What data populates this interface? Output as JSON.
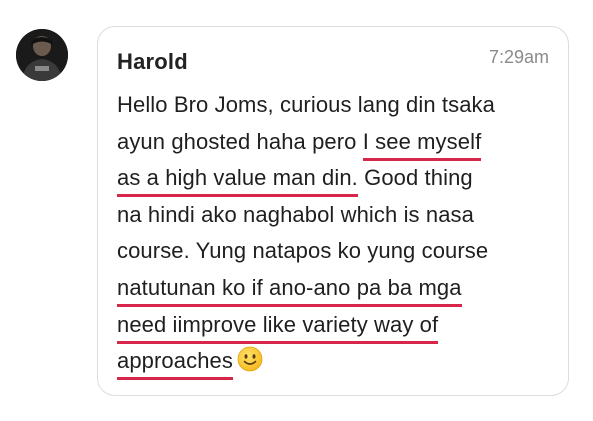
{
  "comment": {
    "author": "Harold",
    "time": "7:29am",
    "lines": [
      {
        "before": "Hello Bro Joms, curious lang din tsaka",
        "highlight": "",
        "after": ""
      },
      {
        "before": "ayun ghosted haha pero ",
        "highlight": "I see myself",
        "after": ""
      },
      {
        "before": "",
        "highlight": "as a high value man din.",
        "after": " Good thing"
      },
      {
        "before": "na hindi ako naghabol which is nasa",
        "highlight": "",
        "after": ""
      },
      {
        "before": "course. Yung natapos ko yung course",
        "highlight": "",
        "after": ""
      },
      {
        "before": "",
        "highlight": "natutunan ko if ano-ano pa ba mga",
        "after": ""
      },
      {
        "before": "",
        "highlight": "need iimprove like variety way of",
        "after": ""
      },
      {
        "before": "",
        "highlight": "approaches",
        "after": ""
      }
    ],
    "emoji": "slightly-smiling-face-icon"
  },
  "colors": {
    "underline": "#d8264a",
    "card_border": "#dddddd",
    "text": "#1f1f1f",
    "time": "#8a8a8a"
  }
}
